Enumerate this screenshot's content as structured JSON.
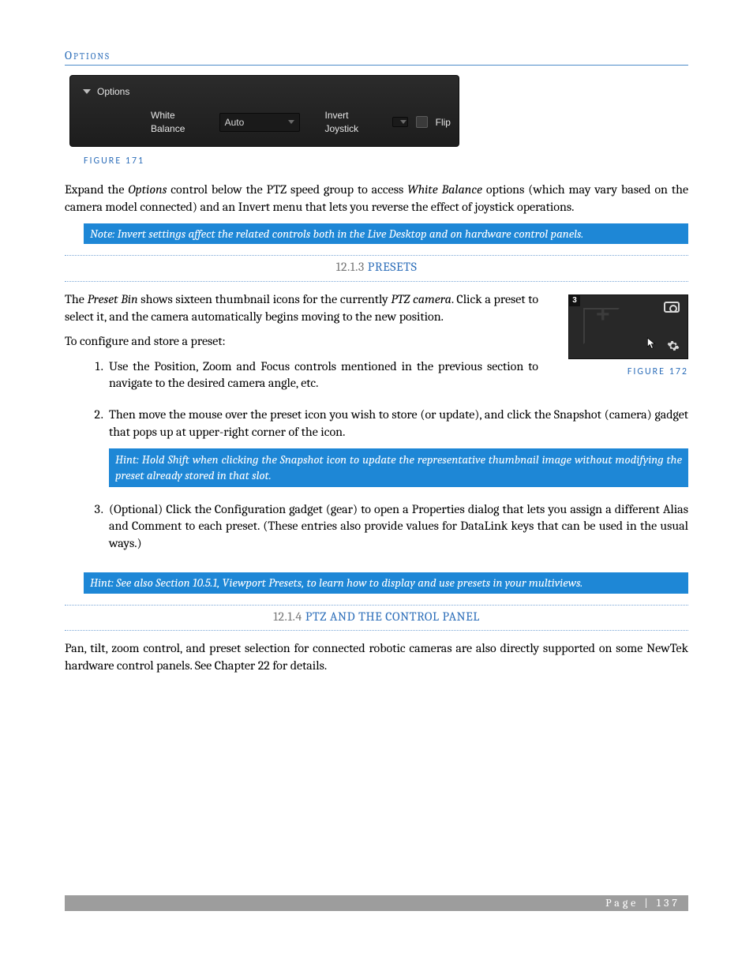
{
  "headings": {
    "options": "Options",
    "fig171": "FIGURE 171",
    "fig172": "FIGURE 172",
    "sec1213_num": "12.1.3 ",
    "sec1213_title": "PRESETS",
    "sec1214_num": "12.1.4 ",
    "sec1214_title": "PTZ AND THE CONTROL PANEL"
  },
  "ui_panel": {
    "options_label": "Options",
    "white_balance_label": "White Balance",
    "white_balance_value": "Auto",
    "invert_label": "Invert Joystick",
    "flip_label": "Flip"
  },
  "paragraphs": {
    "p1_a": "Expand the ",
    "p1_b": "Options",
    "p1_c": " control below the PTZ speed group to access ",
    "p1_d": "White Balance",
    "p1_e": " options (which may vary based on the camera model connected) and an Invert menu that lets you reverse the effect of joystick operations.",
    "note1": "Note: Invert settings affect the related controls both in the Live Desktop and on hardware control panels.",
    "p2_a": "The ",
    "p2_b": "Preset Bin",
    "p2_c": " shows sixteen thumbnail icons for the currently ",
    "p2_d": "PTZ camera",
    "p2_e": ".   Click a preset to select it, and the camera automatically begins moving to the new position.",
    "p3": "To configure and store a preset:",
    "step1_a": "Use the ",
    "step1_b": "Position, Zoom",
    "step1_c": " and ",
    "step1_d": "Focus",
    "step1_e": " controls mentioned in the previous section to navigate to the desired camera angle, etc.",
    "step2_a": "Then move the mouse over the preset icon you wish to store (or update), and click the ",
    "step2_b": "Snapshot",
    "step2_c": " (camera) gadget that pops up at upper-right corner of the icon.",
    "step2_hint": "Hint: Hold Shift when clicking the Snapshot icon to update the representative thumbnail image without modifying the preset already stored in that slot.",
    "step3_a": "(Optional) Click the ",
    "step3_b": "Configuration gadget",
    "step3_c": " (gear) to open a Properties dialog that lets you assign a different ",
    "step3_d": "Alias",
    "step3_e": " and ",
    "step3_f": "Comment",
    "step3_g": " to each preset.  (These entries also provide values for ",
    "step3_h": "DataLink",
    "step3_i": " keys that can be used in the usual ways.)",
    "hint2": "Hint: See also Section 10.5.1, Viewport Presets, to learn how to display and use presets in your multiviews.",
    "p4": "Pan, tilt, zoom control, and preset selection for connected robotic cameras are also directly supported on some NewTek hardware control panels.  See Chapter 22 for details."
  },
  "preset_thumb": {
    "badge": "3"
  },
  "footer": {
    "text": "Page | 137"
  }
}
